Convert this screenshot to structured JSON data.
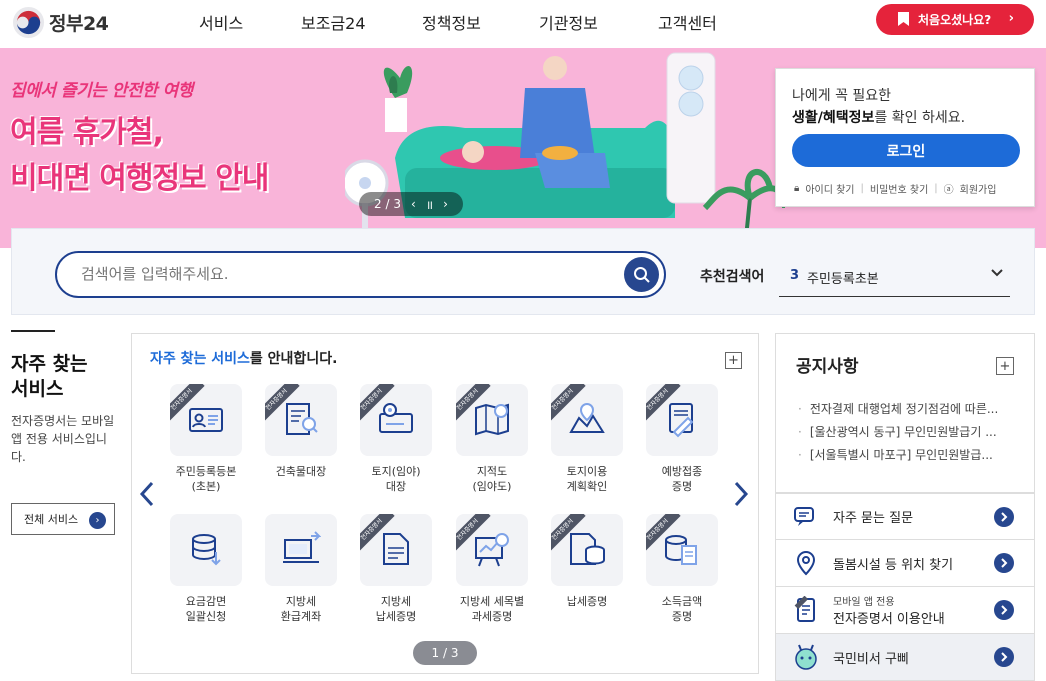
{
  "header": {
    "logo_text": "정부24",
    "nav": [
      "서비스",
      "보조금24",
      "정책정보",
      "기관정보",
      "고객센터"
    ],
    "first_visit_label": "처음오셨나요?"
  },
  "banner": {
    "subtitle": "집에서 즐기는 안전한 여행",
    "title_line1": "여름 휴가철,",
    "title_line2": "비대면 여행정보 안내",
    "pager": "2 / 3"
  },
  "login": {
    "line1": "나에게 꼭 필요한",
    "line2_bold": "생활/혜택정보",
    "line2_rest": "를 확인 하세요.",
    "button": "로그인",
    "find_id": "아이디 찾기",
    "find_pw": "비밀번호 찾기",
    "join": "회원가입"
  },
  "search": {
    "placeholder": "검색어를 입력해주세요.",
    "recommend_label": "추천검색어",
    "recommend_num": "3",
    "recommend_value": "주민등록초본"
  },
  "left": {
    "title_line1": "자주 찾는",
    "title_line2": "서비스",
    "desc": "전자증명서는 모바일 앱 전용 서비스입니다.",
    "all_button": "전체 서비스"
  },
  "services": {
    "head_blue": "자주 찾는 서비스",
    "head_rest": "를 안내합니다.",
    "badge": "전자증명서",
    "pager": "1 / 3",
    "items": [
      {
        "line1": "주민등록등본",
        "line2": "(초본)",
        "badge": true,
        "icon": "id-card-icon"
      },
      {
        "line1": "건축물대장",
        "line2": "",
        "badge": true,
        "icon": "building-register-icon"
      },
      {
        "line1": "토지(임야)",
        "line2": "대장",
        "badge": true,
        "icon": "land-register-icon"
      },
      {
        "line1": "지적도",
        "line2": "(임야도)",
        "badge": true,
        "icon": "cadastral-map-icon"
      },
      {
        "line1": "토지이용",
        "line2": "계획확인",
        "badge": true,
        "icon": "land-use-icon"
      },
      {
        "line1": "예방접종",
        "line2": "증명",
        "badge": true,
        "icon": "vaccination-icon"
      },
      {
        "line1": "요금감면",
        "line2": "일괄신청",
        "badge": false,
        "icon": "fee-reduction-icon"
      },
      {
        "line1": "지방세",
        "line2": "환급계좌",
        "badge": false,
        "icon": "tax-refund-icon"
      },
      {
        "line1": "지방세",
        "line2": "납세증명",
        "badge": true,
        "icon": "tax-payment-icon"
      },
      {
        "line1": "지방세 세목별",
        "line2": "과세증명",
        "badge": true,
        "icon": "tax-chart-icon"
      },
      {
        "line1": "납세증명",
        "line2": "",
        "badge": true,
        "icon": "tax-cert-icon"
      },
      {
        "line1": "소득금액",
        "line2": "증명",
        "badge": true,
        "icon": "income-cert-icon"
      }
    ]
  },
  "notice": {
    "title": "공지사항",
    "items": [
      "전자결제 대행업체 정기점검에 따른...",
      "[울산광역시 동구] 무인민원발급기 ...",
      "[서울특별시 마포구] 무인민원발급..."
    ]
  },
  "quick": {
    "faq": "자주 묻는 질문",
    "care": "돌봄시설 등 위치 찾기",
    "mobile_small": "모바일 앱 전용",
    "mobile": "전자증명서 이용안내",
    "assistant": "국민비서 구삐"
  },
  "colors": {
    "accent": "#1d6bd8",
    "navy": "#27478f",
    "red": "#e5233b",
    "banner_pink": "#f9b4d9"
  }
}
